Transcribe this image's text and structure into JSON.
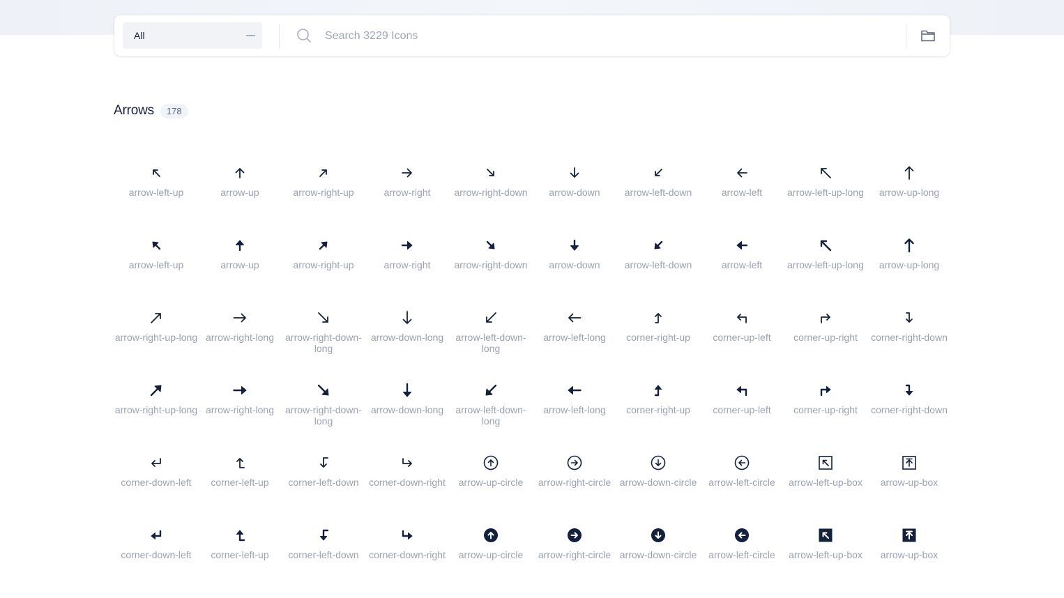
{
  "search": {
    "category_value": "All",
    "placeholder": "Search 3229 Icons"
  },
  "section": {
    "title": "Arrows",
    "count": "178"
  },
  "icons": [
    {
      "label": "arrow-left-up",
      "glyph": "arrow-left-up",
      "variant": "regular"
    },
    {
      "label": "arrow-up",
      "glyph": "arrow-up",
      "variant": "regular"
    },
    {
      "label": "arrow-right-up",
      "glyph": "arrow-right-up",
      "variant": "regular"
    },
    {
      "label": "arrow-right",
      "glyph": "arrow-right",
      "variant": "regular"
    },
    {
      "label": "arrow-right-down",
      "glyph": "arrow-right-down",
      "variant": "regular"
    },
    {
      "label": "arrow-down",
      "glyph": "arrow-down",
      "variant": "regular"
    },
    {
      "label": "arrow-left-down",
      "glyph": "arrow-left-down",
      "variant": "regular"
    },
    {
      "label": "arrow-left",
      "glyph": "arrow-left",
      "variant": "regular"
    },
    {
      "label": "arrow-left-up-long",
      "glyph": "arrow-left-up-long",
      "variant": "regular"
    },
    {
      "label": "arrow-up-long",
      "glyph": "arrow-up-long",
      "variant": "regular"
    },
    {
      "label": "arrow-left-up",
      "glyph": "arrow-left-up",
      "variant": "filled"
    },
    {
      "label": "arrow-up",
      "glyph": "arrow-up",
      "variant": "filled"
    },
    {
      "label": "arrow-right-up",
      "glyph": "arrow-right-up",
      "variant": "filled"
    },
    {
      "label": "arrow-right",
      "glyph": "arrow-right",
      "variant": "filled"
    },
    {
      "label": "arrow-right-down",
      "glyph": "arrow-right-down",
      "variant": "filled"
    },
    {
      "label": "arrow-down",
      "glyph": "arrow-down",
      "variant": "filled"
    },
    {
      "label": "arrow-left-down",
      "glyph": "arrow-left-down",
      "variant": "filled"
    },
    {
      "label": "arrow-left",
      "glyph": "arrow-left",
      "variant": "filled"
    },
    {
      "label": "arrow-left-up-long",
      "glyph": "arrow-left-up-long",
      "variant": "filled"
    },
    {
      "label": "arrow-up-long",
      "glyph": "arrow-up-long",
      "variant": "filled"
    },
    {
      "label": "arrow-right-up-long",
      "glyph": "arrow-right-up-long",
      "variant": "regular"
    },
    {
      "label": "arrow-right-long",
      "glyph": "arrow-right-long",
      "variant": "regular"
    },
    {
      "label": "arrow-right-down-long",
      "glyph": "arrow-right-down-long",
      "variant": "regular"
    },
    {
      "label": "arrow-down-long",
      "glyph": "arrow-down-long",
      "variant": "regular"
    },
    {
      "label": "arrow-left-down-long",
      "glyph": "arrow-left-down-long",
      "variant": "regular"
    },
    {
      "label": "arrow-left-long",
      "glyph": "arrow-left-long",
      "variant": "regular"
    },
    {
      "label": "corner-right-up",
      "glyph": "corner-right-up",
      "variant": "regular"
    },
    {
      "label": "corner-up-left",
      "glyph": "corner-up-left",
      "variant": "regular"
    },
    {
      "label": "corner-up-right",
      "glyph": "corner-up-right",
      "variant": "regular"
    },
    {
      "label": "corner-right-down",
      "glyph": "corner-right-down",
      "variant": "regular"
    },
    {
      "label": "arrow-right-up-long",
      "glyph": "arrow-right-up-long",
      "variant": "filled"
    },
    {
      "label": "arrow-right-long",
      "glyph": "arrow-right-long",
      "variant": "filled"
    },
    {
      "label": "arrow-right-down-long",
      "glyph": "arrow-right-down-long",
      "variant": "filled"
    },
    {
      "label": "arrow-down-long",
      "glyph": "arrow-down-long",
      "variant": "filled"
    },
    {
      "label": "arrow-left-down-long",
      "glyph": "arrow-left-down-long",
      "variant": "filled"
    },
    {
      "label": "arrow-left-long",
      "glyph": "arrow-left-long",
      "variant": "filled"
    },
    {
      "label": "corner-right-up",
      "glyph": "corner-right-up",
      "variant": "filled"
    },
    {
      "label": "corner-up-left",
      "glyph": "corner-up-left",
      "variant": "filled"
    },
    {
      "label": "corner-up-right",
      "glyph": "corner-up-right",
      "variant": "filled"
    },
    {
      "label": "corner-right-down",
      "glyph": "corner-right-down",
      "variant": "filled"
    },
    {
      "label": "corner-down-left",
      "glyph": "corner-down-left",
      "variant": "regular"
    },
    {
      "label": "corner-left-up",
      "glyph": "corner-left-up",
      "variant": "regular"
    },
    {
      "label": "corner-left-down",
      "glyph": "corner-left-down",
      "variant": "regular"
    },
    {
      "label": "corner-down-right",
      "glyph": "corner-down-right",
      "variant": "regular"
    },
    {
      "label": "arrow-up-circle",
      "glyph": "arrow-up-circle",
      "variant": "regular"
    },
    {
      "label": "arrow-right-circle",
      "glyph": "arrow-right-circle",
      "variant": "regular"
    },
    {
      "label": "arrow-down-circle",
      "glyph": "arrow-down-circle",
      "variant": "regular"
    },
    {
      "label": "arrow-left-circle",
      "glyph": "arrow-left-circle",
      "variant": "regular"
    },
    {
      "label": "arrow-left-up-box",
      "glyph": "arrow-left-up-box",
      "variant": "regular"
    },
    {
      "label": "arrow-up-box",
      "glyph": "arrow-up-box",
      "variant": "regular"
    },
    {
      "label": "corner-down-left",
      "glyph": "corner-down-left",
      "variant": "filled"
    },
    {
      "label": "corner-left-up",
      "glyph": "corner-left-up",
      "variant": "filled"
    },
    {
      "label": "corner-left-down",
      "glyph": "corner-left-down",
      "variant": "filled"
    },
    {
      "label": "corner-down-right",
      "glyph": "corner-down-right",
      "variant": "filled"
    },
    {
      "label": "arrow-up-circle",
      "glyph": "arrow-up-circle",
      "variant": "filled"
    },
    {
      "label": "arrow-right-circle",
      "glyph": "arrow-right-circle",
      "variant": "filled"
    },
    {
      "label": "arrow-down-circle",
      "glyph": "arrow-down-circle",
      "variant": "filled"
    },
    {
      "label": "arrow-left-circle",
      "glyph": "arrow-left-circle",
      "variant": "filled"
    },
    {
      "label": "arrow-left-up-box",
      "glyph": "arrow-left-up-box",
      "variant": "filled"
    },
    {
      "label": "arrow-up-box",
      "glyph": "arrow-up-box",
      "variant": "filled"
    }
  ]
}
